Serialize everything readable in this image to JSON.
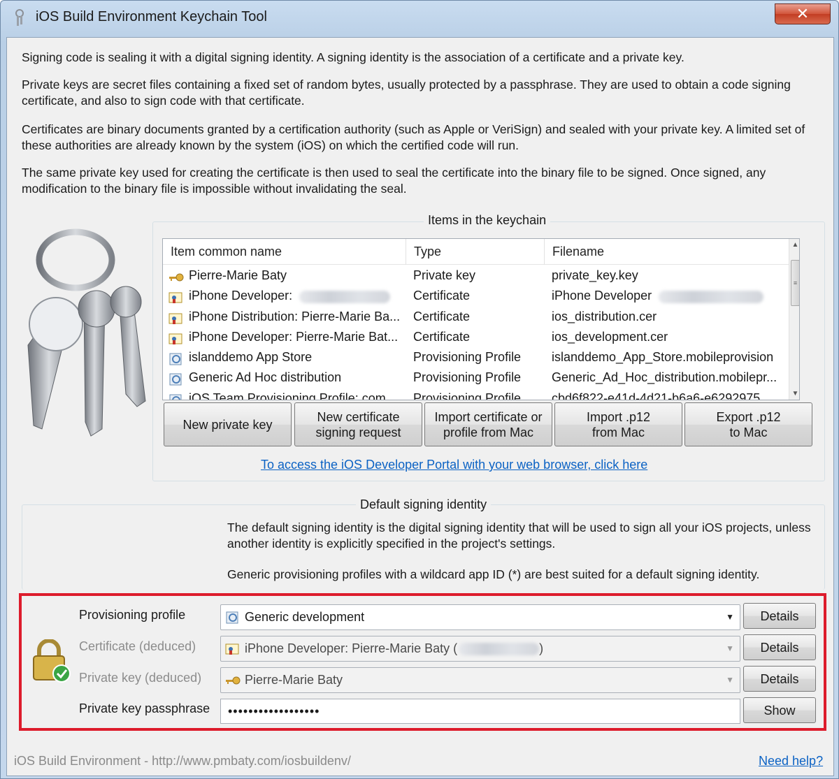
{
  "window": {
    "title": "iOS Build Environment Keychain Tool",
    "close_glyph": "✕"
  },
  "intro": {
    "p1": "Signing code is sealing it with a digital signing identity. A signing identity is the association of a certificate and a private key.",
    "p2": "Private keys are secret files containing a fixed set of random bytes, usually protected by a passphrase. They are used to obtain a code signing certificate, and also to sign code with that certificate.",
    "p3": "Certificates are binary documents granted by a certification authority (such as Apple or VeriSign) and sealed with your private key. A limited set of these authorities are already known by the system (iOS) on which the certified code will run.",
    "p4": "The same private key used for creating the certificate is then used to seal the certificate into the binary file to be signed. Once signed, any modification to the binary file is impossible without invalidating the seal."
  },
  "keychain": {
    "caption": "Items in the keychain",
    "columns": [
      "Item common name",
      "Type",
      "Filename"
    ],
    "rows": [
      {
        "icon": "key-icon",
        "name": "Pierre-Marie Baty",
        "type": "Private key",
        "file": "private_key.key",
        "blur_name": false,
        "blur_file": false
      },
      {
        "icon": "certificate-icon",
        "name": "iPhone Developer:",
        "type": "Certificate",
        "file": "iPhone Developer",
        "blur_name": true,
        "blur_file": true
      },
      {
        "icon": "certificate-icon",
        "name": "iPhone Distribution: Pierre-Marie Ba...",
        "type": "Certificate",
        "file": "ios_distribution.cer",
        "blur_name": false,
        "blur_file": false
      },
      {
        "icon": "certificate-icon",
        "name": "iPhone Developer: Pierre-Marie Bat...",
        "type": "Certificate",
        "file": "ios_development.cer",
        "blur_name": false,
        "blur_file": false
      },
      {
        "icon": "provisioning-profile-icon",
        "name": "islanddemo App Store",
        "type": "Provisioning Profile",
        "file": "islanddemo_App_Store.mobileprovision",
        "blur_name": false,
        "blur_file": false
      },
      {
        "icon": "provisioning-profile-icon",
        "name": "Generic Ad Hoc distribution",
        "type": "Provisioning Profile",
        "file": "Generic_Ad_Hoc_distribution.mobilepr...",
        "blur_name": false,
        "blur_file": false
      },
      {
        "icon": "provisioning-profile-icon",
        "name": "iOS Team Provisioning Profile: com...",
        "type": "Provisioning Profile",
        "file": "cbd6f822-e41d-4d21-b6a6-e6292975...",
        "blur_name": false,
        "blur_file": false
      }
    ],
    "buttons": {
      "new_key": "New private key",
      "new_csr_1": "New certificate",
      "new_csr_2": "signing request",
      "import_1": "Import certificate or",
      "import_2": "profile from Mac",
      "import_p12_1": "Import .p12",
      "import_p12_2": "from Mac",
      "export_p12_1": "Export .p12",
      "export_p12_2": "to Mac"
    },
    "portal_link": "To access the iOS Developer Portal with your web browser, click here"
  },
  "identity": {
    "caption": "Default signing identity",
    "desc1": "The default signing identity is the digital signing identity that will be used to sign all your iOS projects, unless another identity is explicitly specified in the project's settings.",
    "desc2": "Generic provisioning profiles with a wildcard app ID (*) are best suited for a default signing identity.",
    "profile_label": "Provisioning profile",
    "profile_value": "Generic development",
    "cert_label": "Certificate (deduced)",
    "cert_value": "iPhone Developer: Pierre-Marie Baty (",
    "cert_close": ")",
    "key_label": "Private key (deduced)",
    "key_value": "Pierre-Marie Baty",
    "pass_label": "Private key passphrase",
    "pass_value": "••••••••••••••••••",
    "details": "Details",
    "show": "Show",
    "dropdown_glyph": "▼"
  },
  "footer": {
    "left": "iOS Build Environment - http://www.pmbaty.com/iosbuildenv/",
    "help": "Need help?"
  },
  "colors": {
    "highlight": "#dd1c2c",
    "link": "#0b62c4"
  }
}
